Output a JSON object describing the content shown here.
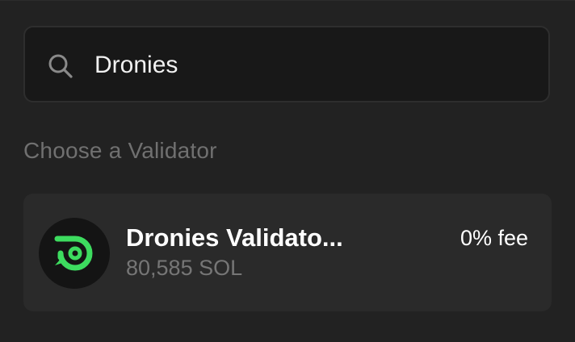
{
  "search": {
    "value": "Dronies",
    "icon": "search-icon"
  },
  "section": {
    "heading": "Choose a Validator"
  },
  "validators": [
    {
      "name": "Dronies Validato...",
      "stake": "80,585 SOL",
      "fee": "0% fee",
      "icon": "dronies-logo-icon",
      "logo_color": "#3ddc5f"
    }
  ],
  "colors": {
    "background": "#222222",
    "search_background": "#181818",
    "card_background": "#2a2a2a",
    "muted_text": "#707070",
    "accent_green": "#3ddc5f"
  }
}
